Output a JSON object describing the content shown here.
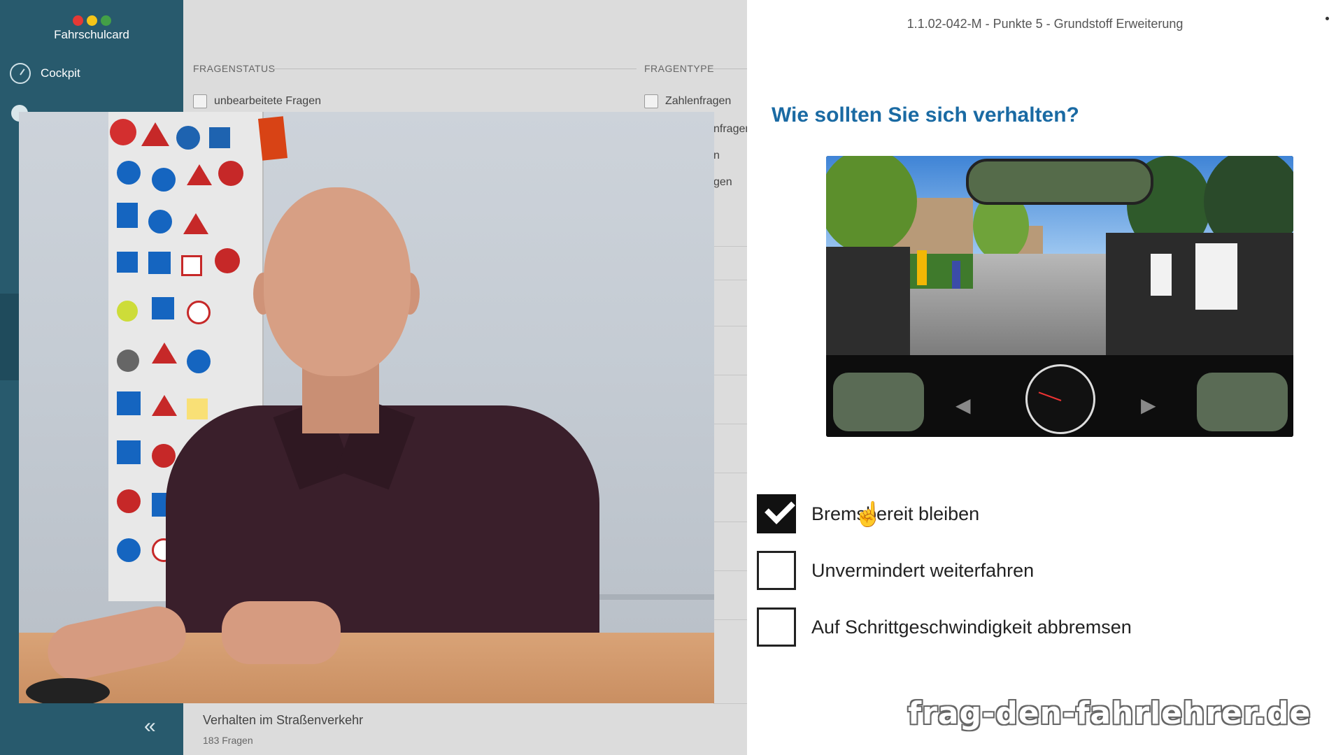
{
  "app": {
    "logo_text": "Fahrschulcard",
    "logo_colors": [
      "#e53935",
      "#f5c518",
      "#43a047"
    ]
  },
  "sidebar": {
    "items": [
      {
        "label": "Cockpit",
        "icon": "gauge-icon"
      }
    ],
    "collapse_glyph": "«"
  },
  "filters": {
    "status_label": "FRAGENSTATUS",
    "type_label": "FRAGENTYPE",
    "status_options": [
      "unbearbeitete Fragen"
    ],
    "type_options": [
      "Zahlenfragen"
    ],
    "partial_labels": [
      "nfragen",
      "n",
      "gen"
    ]
  },
  "list": {
    "title": "Verhalten im Straßenverkehr",
    "subtitle": "183 Fragen"
  },
  "question": {
    "id_line": "1.1.02-042-M - Punkte 5 - Grundstoff Erweiterung",
    "title": "Wie sollten Sie sich verhalten?",
    "answers": [
      {
        "text": "Bremsbereit bleiben",
        "checked": true
      },
      {
        "text": "Unvermindert weiterfahren",
        "checked": false
      },
      {
        "text": "Auf Schrittgeschwindigkeit abbremsen",
        "checked": false
      }
    ]
  },
  "watermark": "frag-den-fahrlehrer.de",
  "colors": {
    "sidebar": "#285a6d",
    "title_blue": "#1a6aa3",
    "panel_bg": "#ffffff",
    "main_bg": "#dcdcdc"
  }
}
